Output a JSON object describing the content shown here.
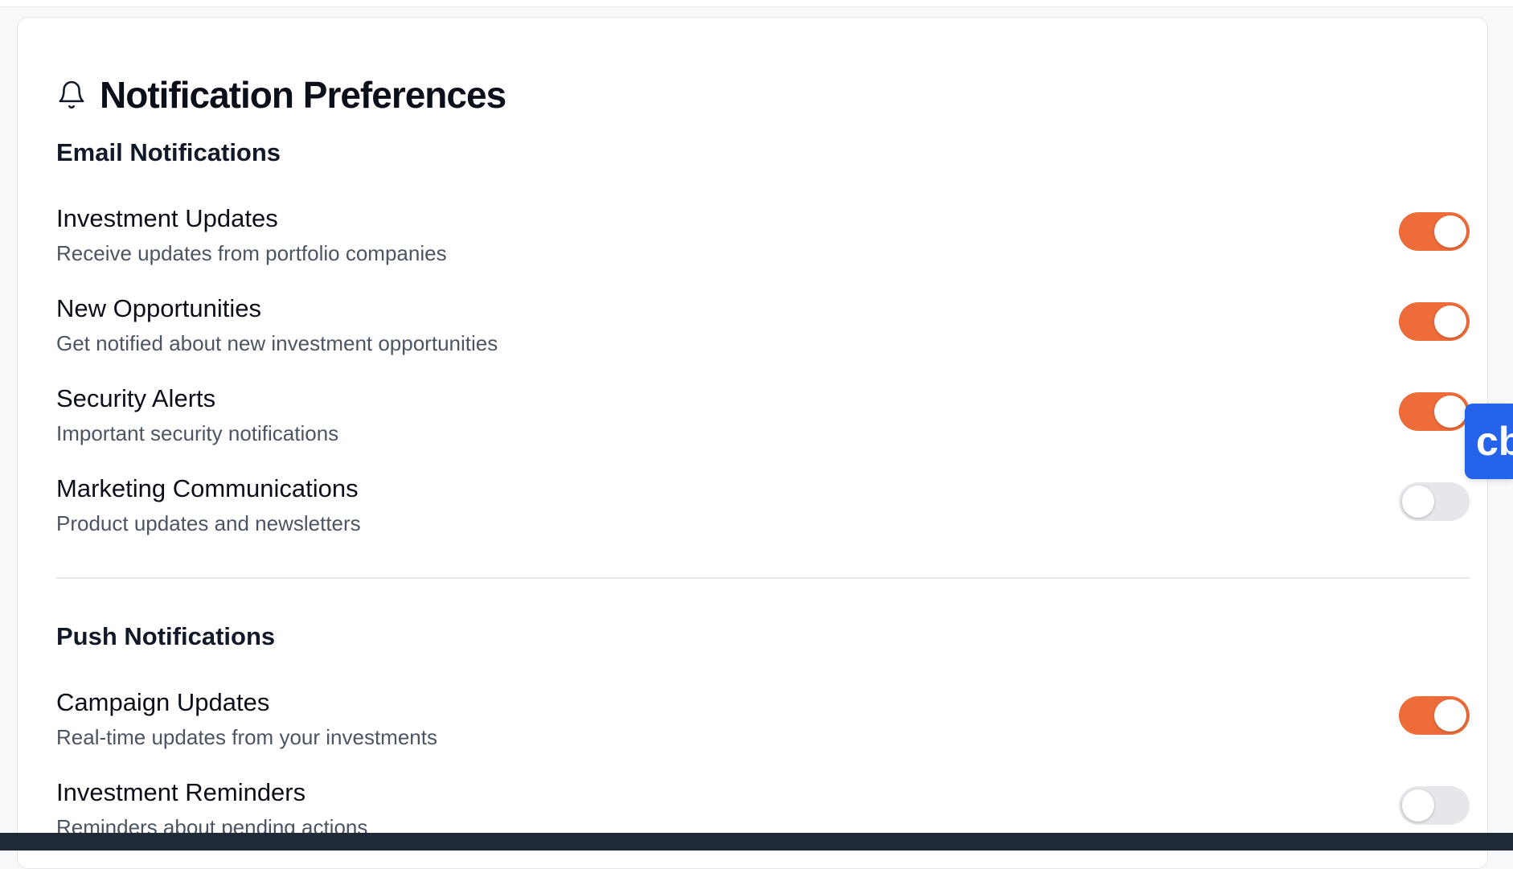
{
  "header": {
    "title": "Notification Preferences",
    "icon": "bell-icon"
  },
  "sections": {
    "email": {
      "title": "Email Notifications",
      "items": [
        {
          "label": "Investment Updates",
          "description": "Receive updates from portfolio companies",
          "enabled": true
        },
        {
          "label": "New Opportunities",
          "description": "Get notified about new investment opportunities",
          "enabled": true
        },
        {
          "label": "Security Alerts",
          "description": "Important security notifications",
          "enabled": true
        },
        {
          "label": "Marketing Communications",
          "description": "Product updates and newsletters",
          "enabled": false
        }
      ]
    },
    "push": {
      "title": "Push Notifications",
      "items": [
        {
          "label": "Campaign Updates",
          "description": "Real-time updates from your investments",
          "enabled": true
        },
        {
          "label": "Investment Reminders",
          "description": "Reminders about pending actions",
          "enabled": false
        }
      ]
    }
  },
  "side_tab": {
    "label": "cb"
  },
  "colors": {
    "toggle_on": "#ee6c3a",
    "toggle_off": "#e5e7eb",
    "side_tab": "#2563eb"
  }
}
